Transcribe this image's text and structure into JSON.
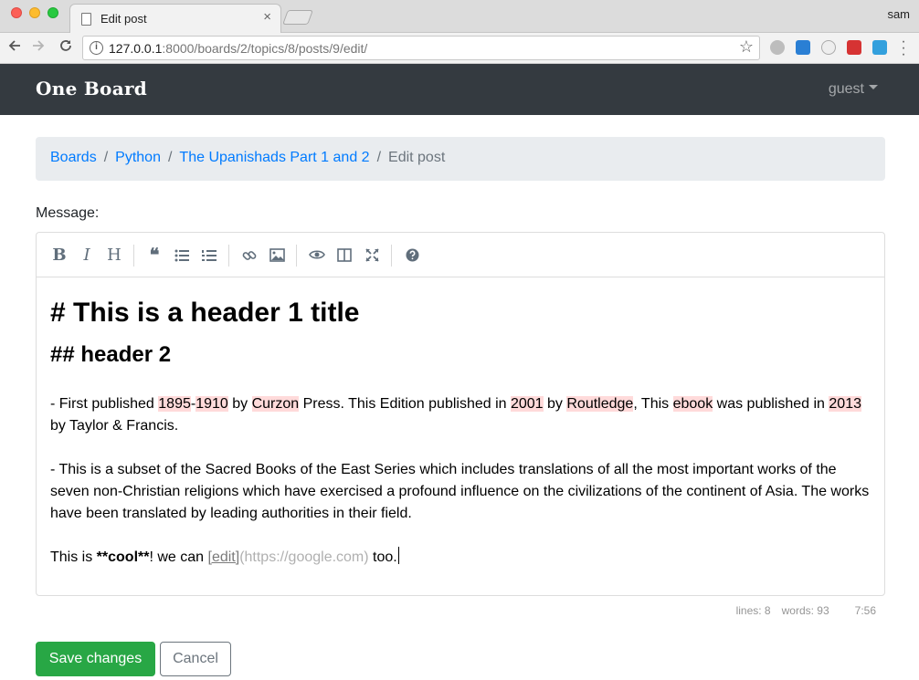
{
  "browser": {
    "tab_title": "Edit post",
    "tab_close": "×",
    "profile_name": "sam",
    "url_host": "127.0.0.1",
    "url_rest": ":8000/boards/2/topics/8/posts/9/edit/",
    "icons": [
      "back-arrow-icon",
      "forward-arrow-icon",
      "reload-icon",
      "info-icon",
      "star-icon",
      "menu-dots-icon"
    ]
  },
  "navbar": {
    "brand": "One Board",
    "user": "guest"
  },
  "breadcrumb": {
    "items": [
      "Boards",
      "Python",
      "The Upanishads Part 1 and 2"
    ],
    "active": "Edit post",
    "separator": "/"
  },
  "form": {
    "message_label": "Message:",
    "save_label": "Save changes",
    "cancel_label": "Cancel"
  },
  "editor": {
    "toolbar": {
      "bold": "B",
      "italic": "I",
      "heading": "H",
      "quote": "❝"
    },
    "h1": "# This is a header 1 title",
    "h2": "## header 2",
    "para1": {
      "t1": "- First published ",
      "y1": "1895",
      "t2": "-",
      "y2": "1910",
      "t3": " by ",
      "w1": "Curzon",
      "t4": " Press. This Edition published in ",
      "y3": "2001",
      "t5": " by ",
      "w2": "Routledge",
      "t6": ", This ",
      "w3": "ebook",
      "t7": " was published in ",
      "y4": "2013",
      "t8": " by Taylor & Francis."
    },
    "para2": "- This is a subset of the Sacred Books of the East Series which includes translations of all the most important works of the seven non-Christian religions which have exercised a profound influence on the civilizations of the continent of Asia. The works have been translated by leading authorities in their field.",
    "para3": {
      "t1": "This is ",
      "bold": "**cool**",
      "t2": "! we can ",
      "link": "[edit]",
      "url": "(https://google.com)",
      "t3": " too."
    },
    "highlight_color": "#ffdada"
  },
  "statusbar": {
    "lines": "lines: 8",
    "words": "words: 93",
    "cursor": "7:56"
  },
  "colors": {
    "navbar": "#343a40",
    "link": "#007bff",
    "save": "#28a745",
    "cancel": "#6c757d"
  }
}
